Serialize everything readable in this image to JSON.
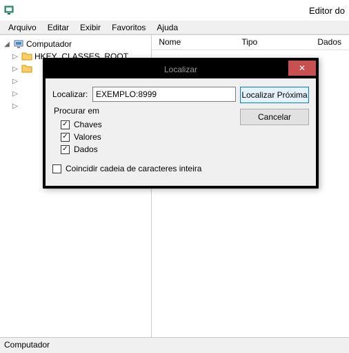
{
  "window": {
    "title": "Editor do"
  },
  "menu": {
    "arquivo": "Arquivo",
    "editar": "Editar",
    "exibir": "Exibir",
    "favoritos": "Favoritos",
    "ajuda": "Ajuda"
  },
  "tree": {
    "root": "Computador",
    "child1": "HKEY_CLASSES_ROOT"
  },
  "columns": {
    "nome": "Nome",
    "tipo": "Tipo",
    "dados": "Dados"
  },
  "status": "Computador",
  "dialog": {
    "title": "Localizar",
    "find_label": "Localizar:",
    "find_value": "EXEMPLO:8999",
    "btn_next": "Localizar Próxima",
    "btn_cancel": "Cancelar",
    "group_title": "Procurar em",
    "chk_keys": "Chaves",
    "chk_values": "Valores",
    "chk_data": "Dados",
    "chk_whole": "Coincidir cadeia de caracteres inteira"
  }
}
